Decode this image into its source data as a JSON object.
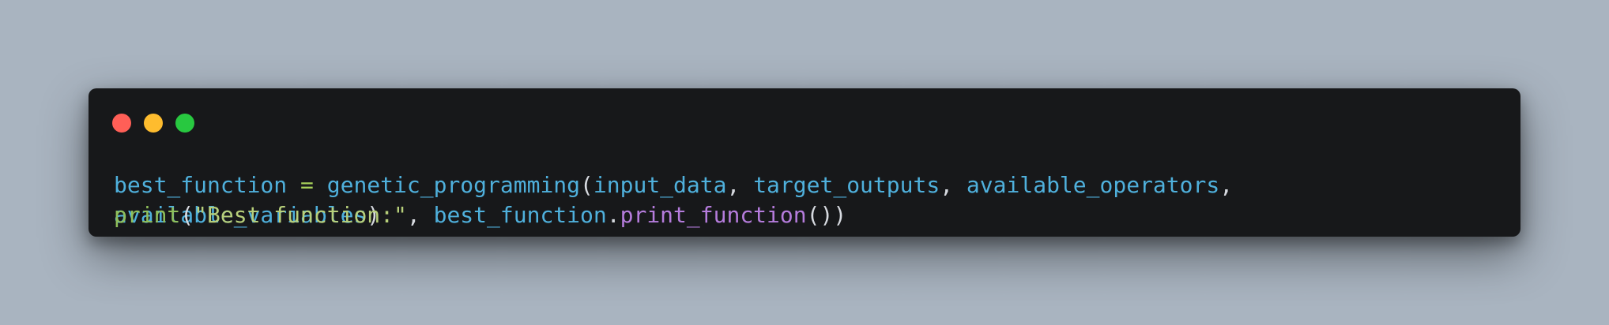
{
  "colors": {
    "background": "#a9b4c0",
    "window": "#17181a",
    "dot_red": "#ff5f57",
    "dot_yellow": "#febc2e",
    "dot_green": "#28c840",
    "identifier": "#4fb0dc",
    "operator": "#a7d05a",
    "punctuation": "#d7dae0",
    "string": "#b7cf7a",
    "builtin": "#8fbf5a",
    "method": "#b57cdc"
  },
  "window_controls": [
    "close",
    "minimize",
    "maximize"
  ],
  "code_lines": [
    {
      "name": "code-line-1",
      "tokens": [
        {
          "t": "best_function",
          "k": "identifier"
        },
        {
          "t": " ",
          "k": "punctuation"
        },
        {
          "t": "=",
          "k": "operator"
        },
        {
          "t": " ",
          "k": "punctuation"
        },
        {
          "t": "genetic_programming",
          "k": "identifier"
        },
        {
          "t": "(",
          "k": "punctuation"
        },
        {
          "t": "input_data",
          "k": "identifier"
        },
        {
          "t": ", ",
          "k": "punctuation"
        },
        {
          "t": "target_outputs",
          "k": "identifier"
        },
        {
          "t": ", ",
          "k": "punctuation"
        },
        {
          "t": "available_operators",
          "k": "identifier"
        },
        {
          "t": ",",
          "k": "punctuation"
        }
      ]
    },
    {
      "name": "code-line-2",
      "tokens": [
        {
          "t": "available_variables",
          "k": "identifier"
        },
        {
          "t": ")",
          "k": "punctuation"
        }
      ]
    },
    {
      "name": "code-line-3",
      "tokens": [
        {
          "t": "print",
          "k": "builtin"
        },
        {
          "t": "(",
          "k": "punctuation"
        },
        {
          "t": "\"Best function:\"",
          "k": "string"
        },
        {
          "t": ", ",
          "k": "punctuation"
        },
        {
          "t": "best_function",
          "k": "identifier"
        },
        {
          "t": ".",
          "k": "punctuation"
        },
        {
          "t": "print_function",
          "k": "method"
        },
        {
          "t": "())",
          "k": "punctuation"
        }
      ]
    }
  ]
}
